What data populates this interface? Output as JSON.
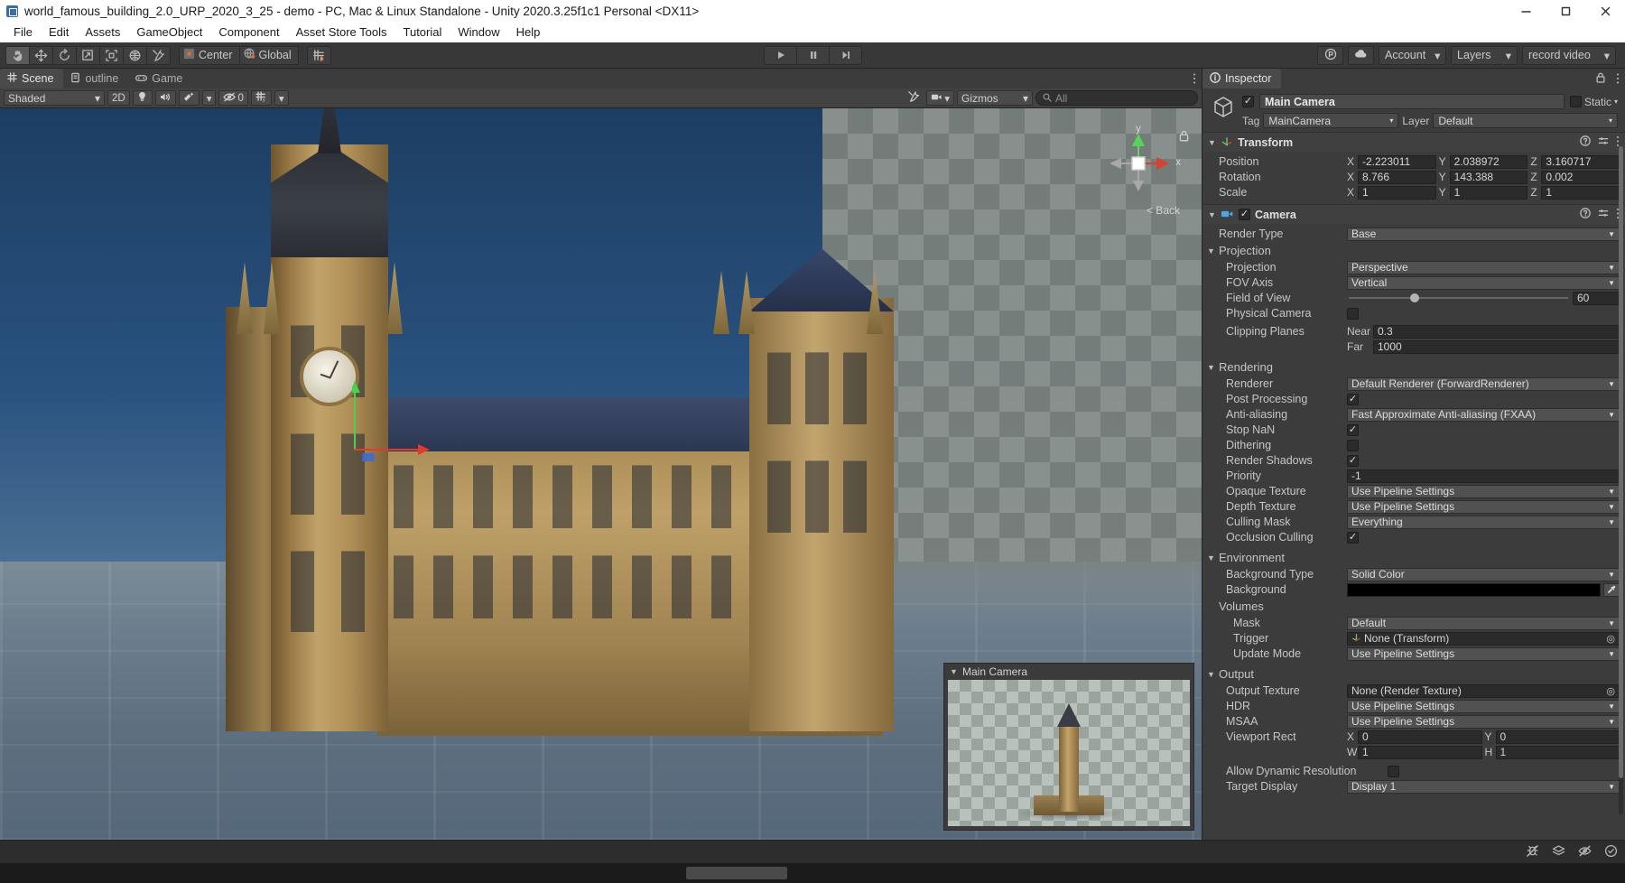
{
  "window": {
    "title": "world_famous_building_2.0_URP_2020_3_25 - demo - PC, Mac & Linux Standalone - Unity 2020.3.25f1c1 Personal <DX11>",
    "app_icon": "unity-icon",
    "minimize": "minimize-icon",
    "maximize": "maximize-icon",
    "close": "close-icon"
  },
  "menu": {
    "items": [
      "File",
      "Edit",
      "Assets",
      "GameObject",
      "Component",
      "Asset Store Tools",
      "Tutorial",
      "Window",
      "Help"
    ]
  },
  "toolbar": {
    "tools": [
      {
        "name": "hand-tool",
        "icon": "hand-icon",
        "active": true
      },
      {
        "name": "move-tool",
        "icon": "move-icon",
        "active": false
      },
      {
        "name": "rotate-tool",
        "icon": "rotate-icon",
        "active": false
      },
      {
        "name": "scale-tool",
        "icon": "scale-icon",
        "active": false
      },
      {
        "name": "rect-tool",
        "icon": "rect-icon",
        "active": false
      },
      {
        "name": "transform-tool",
        "icon": "transform-icon",
        "active": false
      },
      {
        "name": "custom-tool",
        "icon": "wrench-icon",
        "active": false
      }
    ],
    "pivot_label": "Center",
    "space_label": "Global",
    "snap_icon": "grid-snap-icon",
    "play": "play-icon",
    "pause": "pause-icon",
    "step": "step-icon",
    "collab_icon": "collab-icon",
    "cloud_icon": "cloud-icon",
    "account_label": "Account",
    "layers_label": "Layers",
    "layout_label": "record video"
  },
  "scene": {
    "tabs": [
      {
        "label": "Scene",
        "icon": "scene-grid-icon",
        "active": true
      },
      {
        "label": "outline",
        "icon": "hierarchy-icon",
        "active": false
      },
      {
        "label": "Game",
        "icon": "game-pad-icon",
        "active": false
      }
    ],
    "draw_mode": "Shaded",
    "mode_2d": "2D",
    "lighting_icon": "lightbulb-icon",
    "audio_icon": "speaker-icon",
    "fx_icon": "fx-icon",
    "hidden_count": "0",
    "grid_icon": "grid-visibility-icon",
    "tools_icon": "scene-tools-icon",
    "camera_icon": "scene-camera-icon",
    "gizmos_label": "Gizmos",
    "search_placeholder": "All",
    "viewcube": {
      "x_label": "x",
      "y_label": "y",
      "persp_label": "< Back",
      "lock_icon": "lock-icon"
    },
    "camera_preview": {
      "title": "Main Camera"
    }
  },
  "inspector": {
    "tab_label": "Inspector",
    "tab_icon": "info-icon",
    "lock_icon": "lock-icon",
    "kebab_icon": "kebab-icon",
    "object": {
      "icon": "prefab-cube-icon",
      "enabled": true,
      "name": "Main Camera",
      "static_label": "Static",
      "tag_label": "Tag",
      "tag_value": "MainCamera",
      "layer_label": "Layer",
      "layer_value": "Default"
    },
    "transform": {
      "title": "Transform",
      "icon": "transform-axis-icon",
      "help_icon": "help-icon",
      "preset_icon": "preset-icon",
      "kebab_icon": "kebab-icon",
      "rows": [
        {
          "label": "Position",
          "x": "-2.223011",
          "y": "2.038972",
          "z": "3.160717"
        },
        {
          "label": "Rotation",
          "x": "8.766",
          "y": "143.388",
          "z": "0.002"
        },
        {
          "label": "Scale",
          "x": "1",
          "y": "1",
          "z": "1"
        }
      ],
      "axis_labels": [
        "X",
        "Y",
        "Z"
      ]
    },
    "camera": {
      "title": "Camera",
      "icon": "camera-icon",
      "enabled": true,
      "help_icon": "help-icon",
      "preset_icon": "preset-icon",
      "kebab_icon": "kebab-icon",
      "render_type_label": "Render Type",
      "render_type_value": "Base",
      "projection_section": "Projection",
      "projection_label": "Projection",
      "projection_value": "Perspective",
      "fov_axis_label": "FOV Axis",
      "fov_axis_value": "Vertical",
      "fov_label": "Field of View",
      "fov_value": "60",
      "fov_percent": 33,
      "physical_camera_label": "Physical Camera",
      "physical_camera_on": false,
      "clipping_label": "Clipping Planes",
      "near_label": "Near",
      "near_value": "0.3",
      "far_label": "Far",
      "far_value": "1000",
      "rendering_section": "Rendering",
      "renderer_label": "Renderer",
      "renderer_value": "Default Renderer (ForwardRenderer)",
      "post_processing_label": "Post Processing",
      "post_processing_on": true,
      "antialiasing_label": "Anti-aliasing",
      "antialiasing_value": "Fast Approximate Anti-aliasing (FXAA)",
      "stop_nan_label": "Stop NaN",
      "stop_nan_on": true,
      "dithering_label": "Dithering",
      "dithering_on": false,
      "render_shadows_label": "Render Shadows",
      "render_shadows_on": true,
      "priority_label": "Priority",
      "priority_value": "-1",
      "opaque_texture_label": "Opaque Texture",
      "opaque_texture_value": "Use Pipeline Settings",
      "depth_texture_label": "Depth Texture",
      "depth_texture_value": "Use Pipeline Settings",
      "culling_mask_label": "Culling Mask",
      "culling_mask_value": "Everything",
      "occlusion_culling_label": "Occlusion Culling",
      "occlusion_culling_on": true,
      "environment_section": "Environment",
      "background_type_label": "Background Type",
      "background_type_value": "Solid Color",
      "background_label": "Background",
      "background_color": "#000000",
      "eyedropper_icon": "eyedropper-icon",
      "volumes_section": "Volumes",
      "mask_label": "Mask",
      "mask_value": "Default",
      "trigger_label": "Trigger",
      "trigger_value": "None (Transform)",
      "trigger_icon": "transform-axis-icon",
      "update_mode_label": "Update Mode",
      "update_mode_value": "Use Pipeline Settings",
      "output_section": "Output",
      "output_texture_label": "Output Texture",
      "output_texture_value": "None (Render Texture)",
      "hdr_label": "HDR",
      "hdr_value": "Use Pipeline Settings",
      "msaa_label": "MSAA",
      "msaa_value": "Use Pipeline Settings",
      "viewport_rect_label": "Viewport Rect",
      "viewport_x_label": "X",
      "viewport_x": "0",
      "viewport_y_label": "Y",
      "viewport_y": "0",
      "viewport_w_label": "W",
      "viewport_w": "1",
      "viewport_h_label": "H",
      "viewport_h": "1",
      "allow_dynres_label": "Allow Dynamic Resolution",
      "allow_dynres_on": false,
      "target_display_label": "Target Display",
      "target_display_value": "Display 1"
    }
  },
  "statusbar": {
    "icons": [
      "bug-mute-icon",
      "layers-stack-icon",
      "eye-off-icon",
      "check-circle-icon"
    ]
  }
}
